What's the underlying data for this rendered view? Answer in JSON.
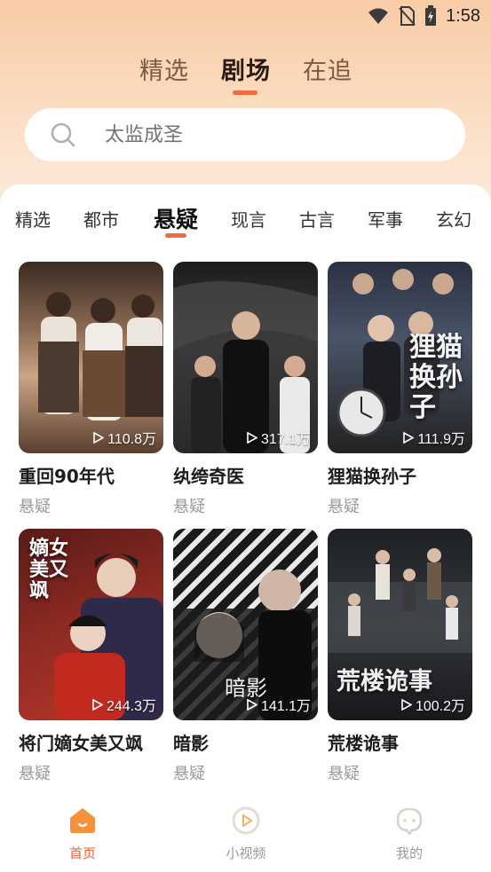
{
  "status_bar": {
    "time": "1:58",
    "icons": [
      "wifi-icon",
      "no-sim-icon",
      "battery-charging-icon"
    ]
  },
  "main_tabs": [
    {
      "label": "精选",
      "active": false
    },
    {
      "label": "剧场",
      "active": true
    },
    {
      "label": "在追",
      "active": false
    }
  ],
  "search": {
    "placeholder": "太监成圣",
    "icon": "search-icon"
  },
  "category_tabs": [
    {
      "label": "精选",
      "active": false
    },
    {
      "label": "都市",
      "active": false
    },
    {
      "label": "悬疑",
      "active": true
    },
    {
      "label": "现言",
      "active": false
    },
    {
      "label": "古言",
      "active": false
    },
    {
      "label": "军事",
      "active": false
    },
    {
      "label": "玄幻",
      "active": false
    }
  ],
  "dramas": [
    {
      "title": "重回90年代",
      "tag": "悬疑",
      "plays": "110.8万"
    },
    {
      "title": "纨绔奇医",
      "tag": "悬疑",
      "plays": "317.1万"
    },
    {
      "title": "狸猫换孙子",
      "tag": "悬疑",
      "plays": "111.9万",
      "poster_text": "狸猫换孙子"
    },
    {
      "title": "将门嫡女美又飒",
      "tag": "悬疑",
      "plays": "244.3万",
      "poster_text": "嫡女美又飒"
    },
    {
      "title": "暗影",
      "tag": "悬疑",
      "plays": "141.1万",
      "poster_text": "暗影"
    },
    {
      "title": "荒楼诡事",
      "tag": "悬疑",
      "plays": "100.2万",
      "poster_text": "荒楼诡事"
    }
  ],
  "bottom_nav": [
    {
      "label": "首页",
      "icon": "home-icon",
      "active": true
    },
    {
      "label": "小视频",
      "icon": "play-circle-icon",
      "active": false
    },
    {
      "label": "我的",
      "icon": "profile-icon",
      "active": false
    }
  ],
  "colors": {
    "accent": "#f26a3d",
    "header_bg": "#f8cca6",
    "tag_gray": "#9a9a9a"
  }
}
